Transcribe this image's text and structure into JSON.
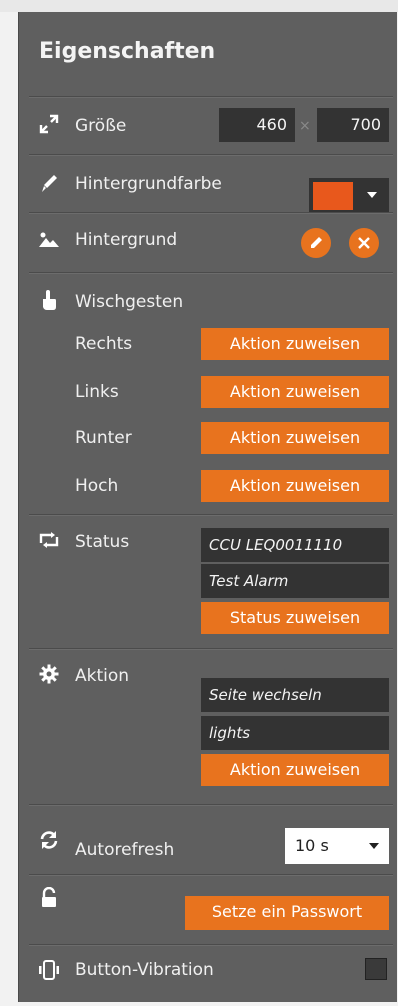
{
  "panel": {
    "title": "Eigenschaften"
  },
  "size": {
    "label": "Größe",
    "width": "460",
    "height": "700",
    "separator": "×"
  },
  "bgcolor": {
    "label": "Hintergrundfarbe",
    "color": "#e8581c"
  },
  "background": {
    "label": "Hintergrund"
  },
  "swipe": {
    "label": "Wischgesten",
    "items": [
      {
        "label": "Rechts",
        "button": "Aktion zuweisen"
      },
      {
        "label": "Links",
        "button": "Aktion zuweisen"
      },
      {
        "label": "Runter",
        "button": "Aktion zuweisen"
      },
      {
        "label": "Hoch",
        "button": "Aktion zuweisen"
      }
    ]
  },
  "status": {
    "label": "Status",
    "field1": "CCU LEQ0011110",
    "field2": "Test Alarm",
    "button": "Status zuweisen"
  },
  "action": {
    "label": "Aktion",
    "field1": "Seite wechseln",
    "field2": "lights",
    "button": "Aktion zuweisen"
  },
  "autorefresh": {
    "label": "Autorefresh",
    "value": "10 s"
  },
  "password": {
    "button": "Setze ein Passwort"
  },
  "vibration": {
    "label": "Button-Vibration"
  },
  "colors": {
    "panel_bg": "#5f5f5f",
    "accent": "#e8731e",
    "field_bg": "#333333"
  }
}
